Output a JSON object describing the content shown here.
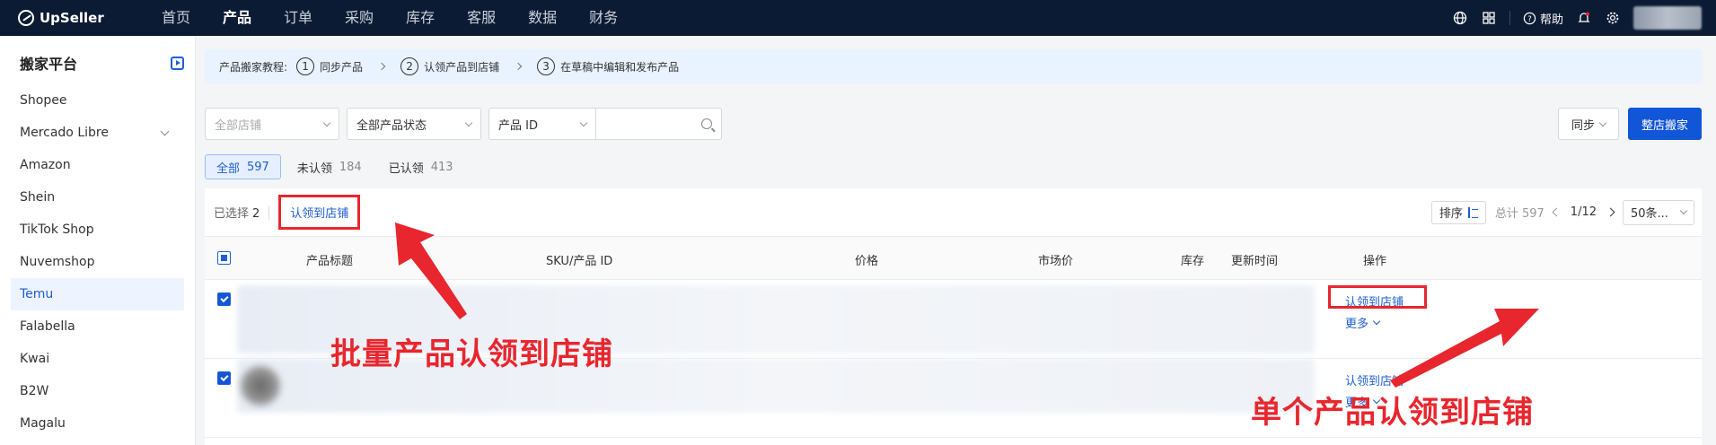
{
  "brand": {
    "name": "UpSeller"
  },
  "nav": {
    "items": [
      "首页",
      "产品",
      "订单",
      "采购",
      "库存",
      "客服",
      "数据",
      "财务"
    ],
    "active_index": 1
  },
  "topbar": {
    "help_label": "帮助"
  },
  "icons": {
    "globe": "globe-icon",
    "apps": "apps-icon",
    "help": "question-circle-icon",
    "bell": "bell-icon",
    "gear": "gear-icon"
  },
  "sidebar": {
    "title": "搬家平台",
    "items": [
      {
        "label": "Shopee"
      },
      {
        "label": "Mercado Libre",
        "expandable": true
      },
      {
        "label": "Amazon"
      },
      {
        "label": "Shein"
      },
      {
        "label": "TikTok Shop"
      },
      {
        "label": "Nuvemshop"
      },
      {
        "label": "Temu",
        "active": true
      },
      {
        "label": "Falabella"
      },
      {
        "label": "Kwai"
      },
      {
        "label": "B2W"
      },
      {
        "label": "Magalu"
      }
    ]
  },
  "tutorial": {
    "label": "产品搬家教程:",
    "steps": [
      {
        "num": "1",
        "text": "同步产品"
      },
      {
        "num": "2",
        "text": "认领产品到店铺"
      },
      {
        "num": "3",
        "text": "在草稿中编辑和发布产品"
      }
    ]
  },
  "filters": {
    "store_placeholder": "全部店铺",
    "status_value": "全部产品状态",
    "search_field": "产品 ID",
    "search_value": ""
  },
  "actions": {
    "sync_label": "同步",
    "move_store_label": "整店搬家"
  },
  "status_tabs": [
    {
      "label": "全部",
      "count": "597",
      "active": true
    },
    {
      "label": "未认领",
      "count": "184"
    },
    {
      "label": "已认领",
      "count": "413"
    }
  ],
  "toolbar": {
    "selected_label": "已选择",
    "selected_count": "2",
    "bulk_claim_label": "认领到店铺",
    "sort_label": "排序",
    "total_label": "总计 597",
    "page": "1/12",
    "page_size": "50条..."
  },
  "table": {
    "columns": [
      "产品标题",
      "SKU/产品 ID",
      "价格",
      "市场价",
      "库存",
      "更新时间",
      "操作"
    ],
    "rows": [
      {
        "checked": true,
        "claim_label": "认领到店铺",
        "more_label": "更多"
      },
      {
        "checked": true,
        "claim_label": "认领到店铺",
        "more_label": "更多"
      }
    ]
  },
  "annotations": {
    "bulk": "批量产品认领到店铺",
    "single": "单个产品认领到店铺"
  },
  "colors": {
    "topbar_bg": "#0b1b33",
    "accent": "#1256d8",
    "link": "#1f5fd1",
    "annotation_red": "#e8262e",
    "tutorial_bg": "#e9f2ff"
  }
}
